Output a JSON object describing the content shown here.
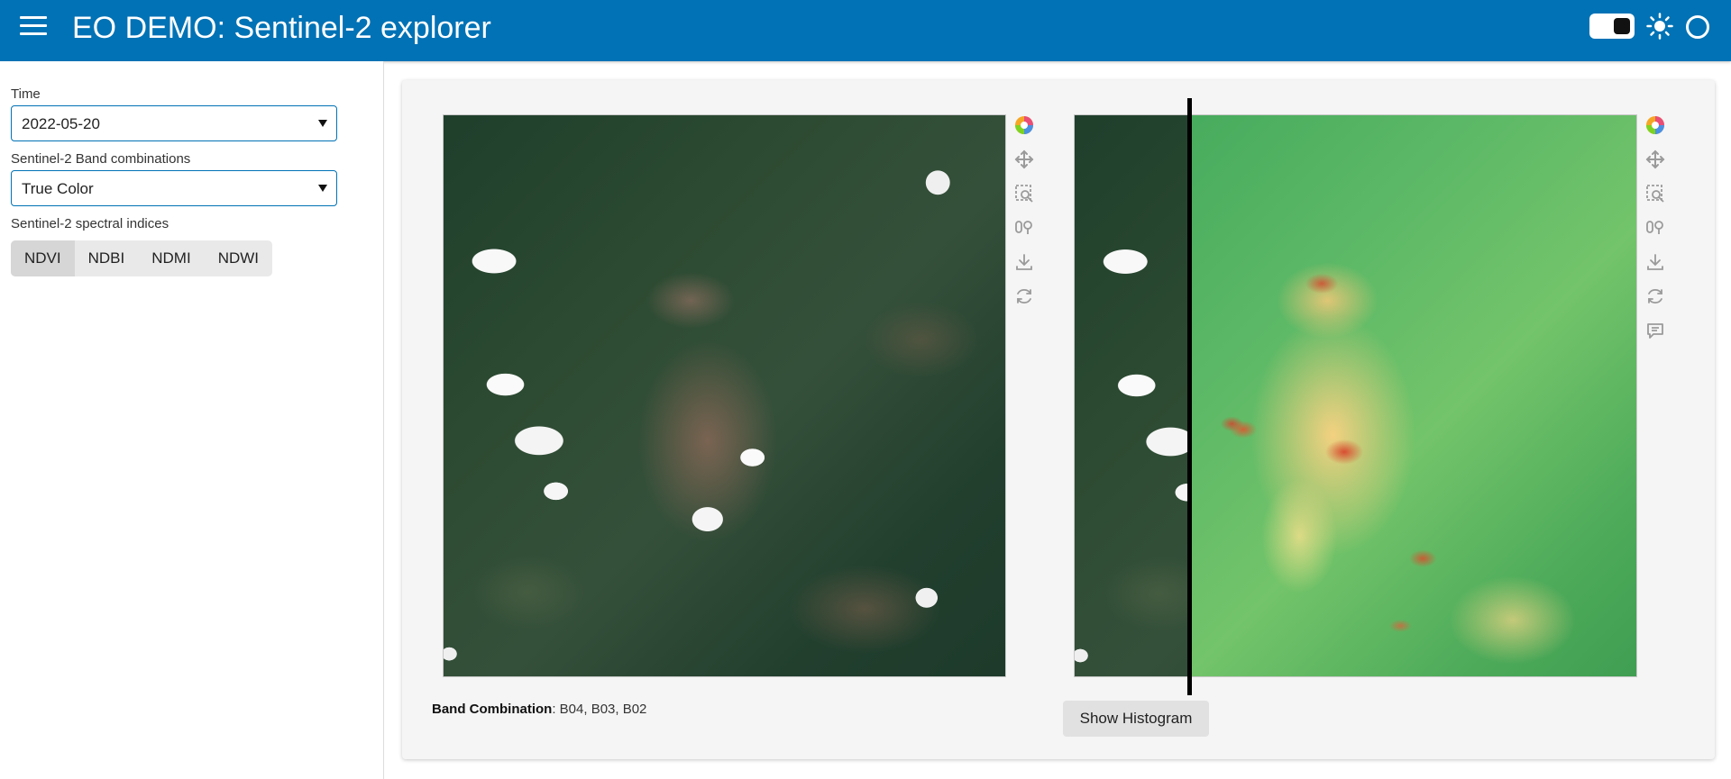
{
  "header": {
    "title": "EO DEMO: Sentinel-2 explorer",
    "background_color": "#0072b5"
  },
  "sidebar": {
    "time_label": "Time",
    "time_value": "2022-05-20",
    "band_combo_label": "Sentinel-2 Band combinations",
    "band_combo_value": "True Color",
    "indices_label": "Sentinel-2 spectral indices",
    "indices": [
      "NDVI",
      "NDBI",
      "NDMI",
      "NDWI"
    ],
    "active_index": "NDVI"
  },
  "main": {
    "band_combination_label": "Band Combination",
    "band_combination_value": ": B04, B03, B02",
    "histogram_button": "Show Histogram"
  },
  "icons": {
    "left_toolbar": [
      "bokeh-logo-icon",
      "pan-icon",
      "box-zoom-icon",
      "wheel-zoom-icon",
      "save-icon",
      "reset-icon"
    ],
    "right_toolbar": [
      "bokeh-logo-icon",
      "pan-icon",
      "box-zoom-icon",
      "wheel-zoom-icon",
      "save-icon",
      "reset-icon",
      "hover-icon"
    ]
  }
}
